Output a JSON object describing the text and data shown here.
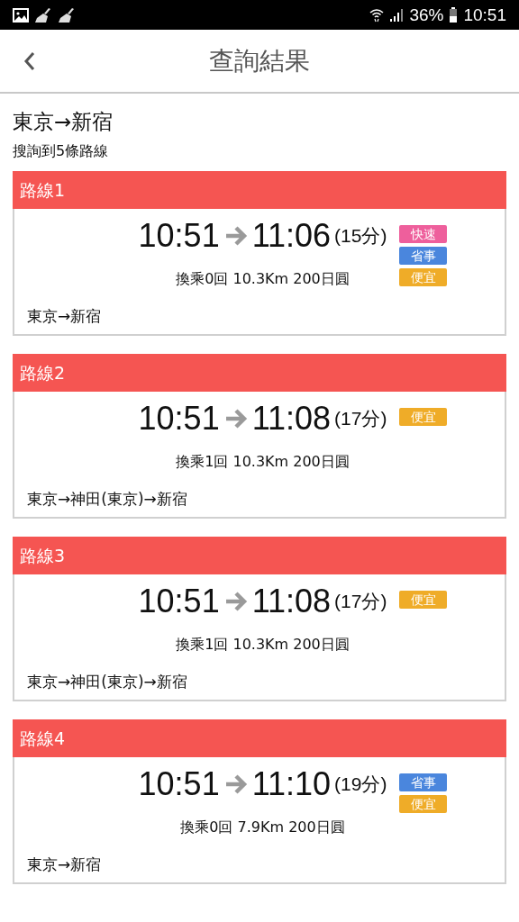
{
  "status_bar": {
    "battery": "36%",
    "time": "10:51"
  },
  "header": {
    "title": "查詢結果"
  },
  "summary": {
    "route": "東京→新宿",
    "count": "搜詢到5條路線"
  },
  "routes": [
    {
      "name": "路線1",
      "depart": "10:51",
      "arrive": "11:06",
      "duration": "(15分)",
      "info": "換乘0回 10.3Km 200日圓",
      "path": "東京→新宿",
      "tags": [
        {
          "label": "快速",
          "color": "#ee5f9c"
        },
        {
          "label": "省事",
          "color": "#4a86dd"
        },
        {
          "label": "便宜",
          "color": "#efac28"
        }
      ]
    },
    {
      "name": "路線2",
      "depart": "10:51",
      "arrive": "11:08",
      "duration": "(17分)",
      "info": "換乘1回 10.3Km 200日圓",
      "path": "東京→神田(東京)→新宿",
      "tags": [
        {
          "label": "便宜",
          "color": "#efac28"
        }
      ]
    },
    {
      "name": "路線3",
      "depart": "10:51",
      "arrive": "11:08",
      "duration": "(17分)",
      "info": "換乘1回 10.3Km 200日圓",
      "path": "東京→神田(東京)→新宿",
      "tags": [
        {
          "label": "便宜",
          "color": "#efac28"
        }
      ]
    },
    {
      "name": "路線4",
      "depart": "10:51",
      "arrive": "11:10",
      "duration": "(19分)",
      "info": "換乘0回 7.9Km 200日圓",
      "path": "東京→新宿",
      "tags": [
        {
          "label": "省事",
          "color": "#4a86dd"
        },
        {
          "label": "便宜",
          "color": "#efac28"
        }
      ]
    }
  ]
}
